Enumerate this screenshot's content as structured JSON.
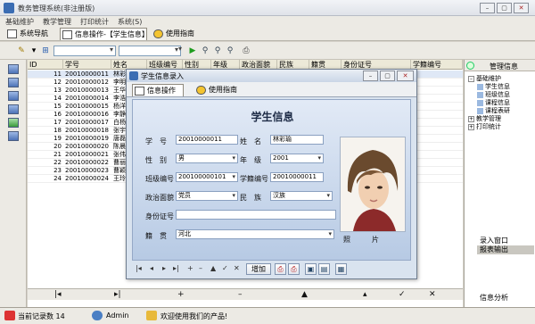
{
  "window": {
    "title": "教务管理系统(非注册版)",
    "min": "–",
    "max": "▢",
    "close": "✕"
  },
  "menu": [
    "基础维护",
    "教学管理",
    "打印统计",
    "系统(S)"
  ],
  "tabs": {
    "nav": "系统导航",
    "info": "信息操作-【学生信息】",
    "help": "使用指南"
  },
  "grid": {
    "columns": [
      "ID",
      "学号",
      "姓名",
      "班级编号",
      "性别",
      "年级",
      "政治面貌",
      "民族",
      "籍贯",
      "身份证号",
      "学籍编号"
    ],
    "rows": [
      [
        "11",
        "20010000011",
        "林彩",
        "",
        "",
        "",
        "",
        "",
        "",
        "",
        ""
      ],
      [
        "12",
        "20010000012",
        "李明",
        "",
        "",
        "",
        "",
        "",
        "",
        "",
        ""
      ],
      [
        "13",
        "20010000013",
        "王华",
        "",
        "",
        "",
        "",
        "",
        "",
        "",
        ""
      ],
      [
        "14",
        "20010000014",
        "李浩",
        "",
        "",
        "",
        "",
        "",
        "",
        "",
        ""
      ],
      [
        "15",
        "20010000015",
        "杨洋",
        "",
        "",
        "",
        "",
        "",
        "",
        "",
        ""
      ],
      [
        "16",
        "20010000016",
        "李静",
        "",
        "",
        "",
        "",
        "",
        "",
        "",
        ""
      ],
      [
        "17",
        "20010000017",
        "白杨",
        "",
        "",
        "",
        "",
        "",
        "",
        "",
        ""
      ],
      [
        "18",
        "20010000018",
        "张宇",
        "",
        "",
        "",
        "",
        "",
        "",
        "",
        ""
      ],
      [
        "19",
        "20010000019",
        "唐磊",
        "",
        "",
        "",
        "",
        "",
        "",
        "",
        ""
      ],
      [
        "20",
        "20010000020",
        "陈晨",
        "",
        "",
        "",
        "",
        "",
        "",
        "",
        ""
      ],
      [
        "21",
        "20010000021",
        "张伟",
        "",
        "",
        "",
        "",
        "",
        "",
        "",
        ""
      ],
      [
        "22",
        "20010000022",
        "曹丽",
        "",
        "",
        "",
        "",
        "",
        "",
        "",
        ""
      ],
      [
        "23",
        "20010000023",
        "曹颖",
        "",
        "",
        "",
        "",
        "",
        "",
        "",
        ""
      ],
      [
        "24",
        "20010000024",
        "王玲",
        "",
        "",
        "",
        "",
        "",
        "",
        "",
        ""
      ]
    ],
    "nav": [
      "|◂",
      "▸|",
      "+",
      "–",
      "▲",
      "▴",
      "✓",
      "✕"
    ]
  },
  "right_panel": {
    "title": "管理信息",
    "tree": [
      {
        "label": "基础维护",
        "level": 0,
        "expander": "–"
      },
      {
        "label": "学生信息",
        "level": 1,
        "expander": ""
      },
      {
        "label": "班级信息",
        "level": 1,
        "expander": ""
      },
      {
        "label": "课程信息",
        "level": 1,
        "expander": ""
      },
      {
        "label": "课程表研",
        "level": 1,
        "expander": ""
      },
      {
        "label": "教学管理",
        "level": 0,
        "expander": "+"
      },
      {
        "label": "打印统计",
        "level": 0,
        "expander": "+"
      }
    ],
    "btn_import": "录入窗口",
    "btn_export": "报表输出",
    "btn_analysis": "信息分析"
  },
  "status": {
    "record": "当前记录数 14",
    "user": "Admin",
    "welcome": "欢迎使用我们的产品!"
  },
  "dialog": {
    "title": "学生信息录入",
    "tab_ops": "信息操作",
    "tab_help": "使用指南",
    "heading": "学生信息",
    "labels": {
      "student_no": "学　号",
      "name": "姓　名",
      "gender": "性　别",
      "grade": "年　级",
      "class_no": "班级编号",
      "reg_no": "学籍编号",
      "politics": "政治面貌",
      "ethnicity": "民　族",
      "id_card": "身份证号",
      "hometown": "籍　贯",
      "photo": "照　　　片"
    },
    "values": {
      "student_no": "20010000011",
      "name": "林彩瑜",
      "gender": "男",
      "grade": "2001",
      "class_no": "200100000101",
      "reg_no": "20010000011",
      "politics": "党员",
      "ethnicity": "汉族",
      "id_card": "",
      "hometown": "河北"
    },
    "nav": [
      "|◂",
      "◂",
      "▸",
      "▸|",
      "+",
      "–",
      "▲",
      "✓",
      "✕"
    ],
    "btn_add": "增加"
  }
}
